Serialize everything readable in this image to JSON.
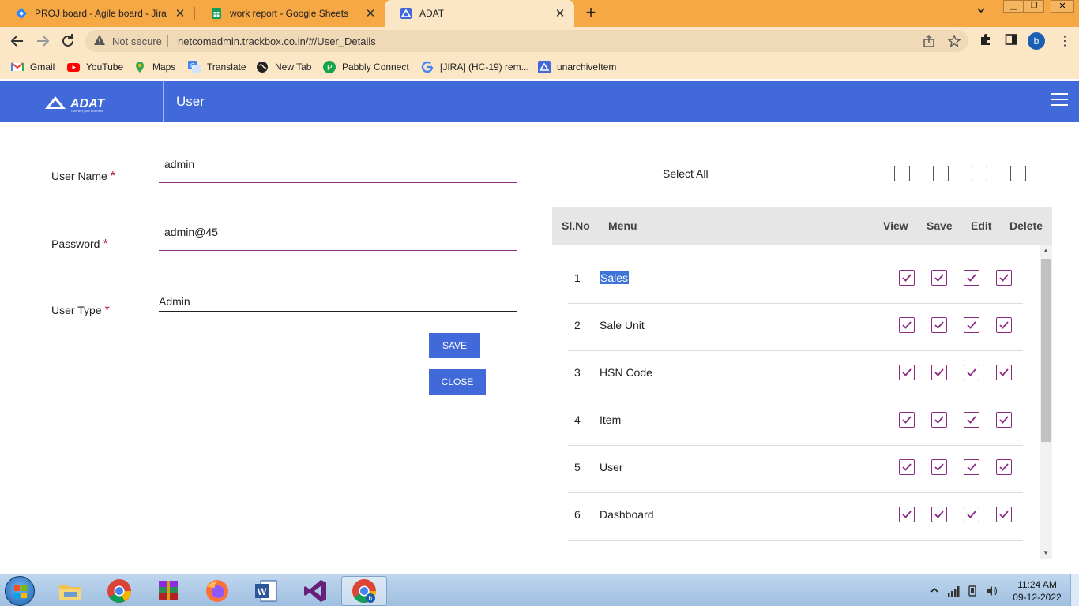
{
  "browser": {
    "tabs": [
      {
        "title": "PROJ board - Agile board - Jira",
        "icon": "jira-icon"
      },
      {
        "title": "work report - Google Sheets",
        "icon": "google-sheets-icon"
      },
      {
        "title": "ADAT",
        "icon": "adat-icon",
        "active": true
      }
    ],
    "new_tab_label": "+",
    "security_label": "Not secure",
    "url": "netcomadmin.trackbox.co.in/#/User_Details",
    "profile_initial": "b",
    "bookmarks": [
      {
        "label": "Gmail",
        "icon": "gmail-icon"
      },
      {
        "label": "YouTube",
        "icon": "youtube-icon"
      },
      {
        "label": "Maps",
        "icon": "maps-icon"
      },
      {
        "label": "Translate",
        "icon": "translate-icon"
      },
      {
        "label": "New Tab",
        "icon": "globe-icon"
      },
      {
        "label": "Pabbly Connect",
        "icon": "pabbly-icon"
      },
      {
        "label": "[JIRA] (HC-19) rem...",
        "icon": "google-icon"
      },
      {
        "label": "unarchiveItem",
        "icon": "adat-icon"
      }
    ]
  },
  "app": {
    "logo_text": "ADAT",
    "logo_tagline": "Connect your business",
    "page_title": "User"
  },
  "form": {
    "username": {
      "label": "User Name",
      "value": "admin",
      "required": "*"
    },
    "password": {
      "label": "Password",
      "value": "admin@45",
      "required": "*"
    },
    "user_type": {
      "label": "User Type",
      "value": "Admin",
      "required": "*"
    },
    "save_label": "SAVE",
    "close_label": "CLOSE"
  },
  "permissions": {
    "select_all_label": "Select All",
    "columns": [
      "Sl.No",
      "Menu",
      "View",
      "Save",
      "Edit",
      "Delete"
    ],
    "rows": [
      {
        "sl": "1",
        "menu": "Sales",
        "view": true,
        "save": true,
        "edit": true,
        "delete": true,
        "highlighted": true
      },
      {
        "sl": "2",
        "menu": "Sale Unit",
        "view": true,
        "save": true,
        "edit": true,
        "delete": true
      },
      {
        "sl": "3",
        "menu": "HSN Code",
        "view": true,
        "save": true,
        "edit": true,
        "delete": true
      },
      {
        "sl": "4",
        "menu": "Item",
        "view": true,
        "save": true,
        "edit": true,
        "delete": true
      },
      {
        "sl": "5",
        "menu": "User",
        "view": true,
        "save": true,
        "edit": true,
        "delete": true
      },
      {
        "sl": "6",
        "menu": "Dashboard",
        "view": true,
        "save": true,
        "edit": true,
        "delete": true
      }
    ]
  },
  "taskbar": {
    "apps": [
      "file-explorer-icon",
      "chrome-icon",
      "winrar-icon",
      "firefox-icon",
      "word-icon",
      "visual-studio-icon",
      "chrome-profile-icon"
    ],
    "time": "11:24 AM",
    "date": "09-12-2022"
  },
  "colors": {
    "accent": "#4169d9",
    "checkbox": "#8b2a82",
    "required": "#b0122a",
    "tab_strip": "#f5a844",
    "toolbar": "#fbe6c6"
  }
}
